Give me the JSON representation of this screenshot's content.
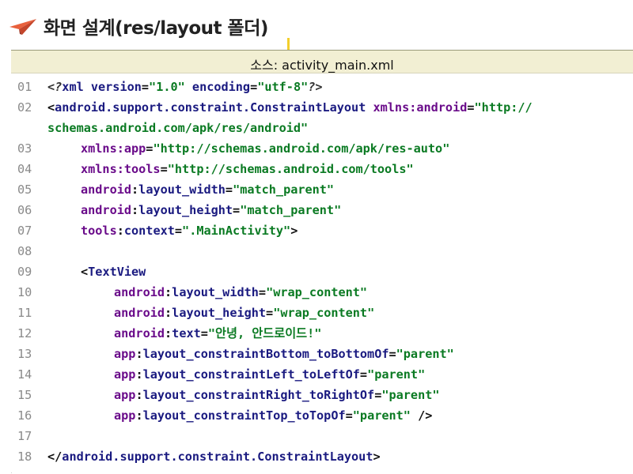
{
  "slide": {
    "title": "화면 설계(res/layout 폴더)",
    "title_icon": "paper-plane-icon",
    "accent_color": "#e8603c"
  },
  "code_block": {
    "header": "소스: activity_main.xml",
    "lines": [
      {
        "no": "01",
        "indent": 0,
        "parts": [
          {
            "t": "<?",
            "c": "meta"
          },
          {
            "t": "xml ",
            "c": "tag"
          },
          {
            "t": "version",
            "c": "attr"
          },
          {
            "t": "=",
            "c": "punct"
          },
          {
            "t": "\"1.0\"",
            "c": "val"
          },
          {
            "t": " ",
            "c": "plain"
          },
          {
            "t": "encoding",
            "c": "attr"
          },
          {
            "t": "=",
            "c": "punct"
          },
          {
            "t": "\"utf-8\"",
            "c": "val"
          },
          {
            "t": "?>",
            "c": "meta"
          }
        ]
      },
      {
        "no": "02",
        "indent": 0,
        "parts": [
          {
            "t": "<",
            "c": "punct"
          },
          {
            "t": "android.support.constraint.ConstraintLayout",
            "c": "tag"
          },
          {
            "t": " ",
            "c": "plain"
          },
          {
            "t": "xmlns:android",
            "c": "ns"
          },
          {
            "t": "=",
            "c": "punct"
          },
          {
            "t": "\"http://",
            "c": "val"
          }
        ]
      },
      {
        "no": "",
        "indent": 0,
        "parts": [
          {
            "t": "schemas.android.com/apk/res/android\"",
            "c": "val"
          }
        ]
      },
      {
        "no": "03",
        "indent": 1,
        "parts": [
          {
            "t": "xmlns:app",
            "c": "ns"
          },
          {
            "t": "=",
            "c": "punct"
          },
          {
            "t": "\"http://schemas.android.com/apk/res-auto\"",
            "c": "val"
          }
        ]
      },
      {
        "no": "04",
        "indent": 1,
        "parts": [
          {
            "t": "xmlns:tools",
            "c": "ns"
          },
          {
            "t": "=",
            "c": "punct"
          },
          {
            "t": "\"http://schemas.android.com/tools\"",
            "c": "val"
          }
        ]
      },
      {
        "no": "05",
        "indent": 1,
        "parts": [
          {
            "t": "android",
            "c": "ns"
          },
          {
            "t": ":",
            "c": "punct"
          },
          {
            "t": "layout_width",
            "c": "attr"
          },
          {
            "t": "=",
            "c": "punct"
          },
          {
            "t": "\"match_parent\"",
            "c": "val"
          }
        ]
      },
      {
        "no": "06",
        "indent": 1,
        "parts": [
          {
            "t": "android",
            "c": "ns"
          },
          {
            "t": ":",
            "c": "punct"
          },
          {
            "t": "layout_height",
            "c": "attr"
          },
          {
            "t": "=",
            "c": "punct"
          },
          {
            "t": "\"match_parent\"",
            "c": "val"
          }
        ]
      },
      {
        "no": "07",
        "indent": 1,
        "parts": [
          {
            "t": "tools",
            "c": "ns"
          },
          {
            "t": ":",
            "c": "punct"
          },
          {
            "t": "context",
            "c": "attr"
          },
          {
            "t": "=",
            "c": "punct"
          },
          {
            "t": "\".MainActivity\"",
            "c": "val"
          },
          {
            "t": ">",
            "c": "punct"
          }
        ]
      },
      {
        "no": "08",
        "indent": 0,
        "parts": []
      },
      {
        "no": "09",
        "indent": 1,
        "parts": [
          {
            "t": "<",
            "c": "punct"
          },
          {
            "t": "TextView",
            "c": "tag"
          }
        ]
      },
      {
        "no": "10",
        "indent": 2,
        "parts": [
          {
            "t": "android",
            "c": "ns"
          },
          {
            "t": ":",
            "c": "punct"
          },
          {
            "t": "layout_width",
            "c": "attr"
          },
          {
            "t": "=",
            "c": "punct"
          },
          {
            "t": "\"wrap_content\"",
            "c": "val"
          }
        ]
      },
      {
        "no": "11",
        "indent": 2,
        "parts": [
          {
            "t": "android",
            "c": "ns"
          },
          {
            "t": ":",
            "c": "punct"
          },
          {
            "t": "layout_height",
            "c": "attr"
          },
          {
            "t": "=",
            "c": "punct"
          },
          {
            "t": "\"wrap_content\"",
            "c": "val"
          }
        ]
      },
      {
        "no": "12",
        "indent": 2,
        "parts": [
          {
            "t": "android",
            "c": "ns"
          },
          {
            "t": ":",
            "c": "punct"
          },
          {
            "t": "text",
            "c": "attr"
          },
          {
            "t": "=",
            "c": "punct"
          },
          {
            "t": "\"안녕, 안드로이드!\"",
            "c": "val"
          }
        ]
      },
      {
        "no": "13",
        "indent": 2,
        "parts": [
          {
            "t": "app",
            "c": "ns"
          },
          {
            "t": ":",
            "c": "punct"
          },
          {
            "t": "layout_constraintBottom_toBottomOf",
            "c": "attr"
          },
          {
            "t": "=",
            "c": "punct"
          },
          {
            "t": "\"parent\"",
            "c": "val"
          }
        ]
      },
      {
        "no": "14",
        "indent": 2,
        "parts": [
          {
            "t": "app",
            "c": "ns"
          },
          {
            "t": ":",
            "c": "punct"
          },
          {
            "t": "layout_constraintLeft_toLeftOf",
            "c": "attr"
          },
          {
            "t": "=",
            "c": "punct"
          },
          {
            "t": "\"parent\"",
            "c": "val"
          }
        ]
      },
      {
        "no": "15",
        "indent": 2,
        "parts": [
          {
            "t": "app",
            "c": "ns"
          },
          {
            "t": ":",
            "c": "punct"
          },
          {
            "t": "layout_constraintRight_toRightOf",
            "c": "attr"
          },
          {
            "t": "=",
            "c": "punct"
          },
          {
            "t": "\"parent\"",
            "c": "val"
          }
        ]
      },
      {
        "no": "16",
        "indent": 2,
        "parts": [
          {
            "t": "app",
            "c": "ns"
          },
          {
            "t": ":",
            "c": "punct"
          },
          {
            "t": "layout_constraintTop_toTopOf",
            "c": "attr"
          },
          {
            "t": "=",
            "c": "punct"
          },
          {
            "t": "\"parent\"",
            "c": "val"
          },
          {
            "t": " />",
            "c": "punct"
          }
        ]
      },
      {
        "no": "17",
        "indent": 0,
        "parts": []
      },
      {
        "no": "18",
        "indent": 0,
        "parts": [
          {
            "t": "</",
            "c": "punct"
          },
          {
            "t": "android.support.constraint.ConstraintLayout",
            "c": "tag"
          },
          {
            "t": ">",
            "c": "punct"
          }
        ]
      }
    ]
  }
}
